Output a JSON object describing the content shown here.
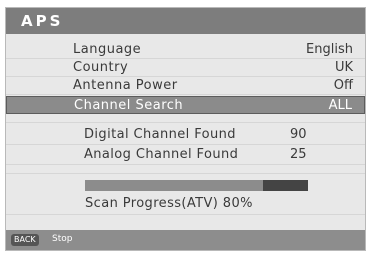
{
  "menu": {
    "title": "APS",
    "items": [
      {
        "label": "Language",
        "value": "English"
      },
      {
        "label": "Country",
        "value": "UK"
      },
      {
        "label": "Antenna Power",
        "value": "Off"
      },
      {
        "label": "Channel Search",
        "value": "ALL",
        "selected": true
      }
    ]
  },
  "scan": {
    "digital_label": "Digital Channel Found",
    "digital_count": "90",
    "analog_label": "Analog Channel Found",
    "analog_count": "25",
    "progress_percent": 80,
    "progress_text": "Scan Progress(ATV) 80%"
  },
  "footer": {
    "back_key": "BACK",
    "stop_label": "Stop"
  }
}
